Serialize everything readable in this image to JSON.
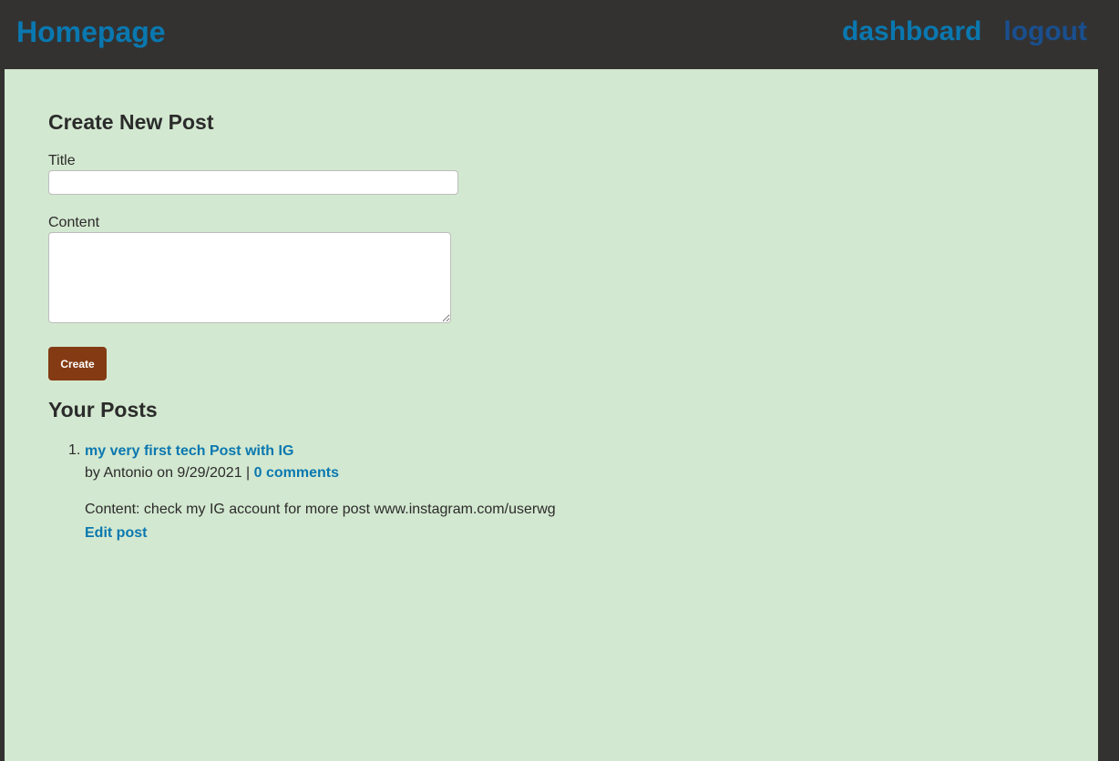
{
  "header": {
    "brand": "Homepage",
    "nav": {
      "dashboard": "dashboard",
      "logout": "logout"
    }
  },
  "create_post": {
    "heading": "Create New Post",
    "title_label": "Title",
    "title_value": "",
    "content_label": "Content",
    "content_value": "",
    "button_label": "Create"
  },
  "your_posts": {
    "heading": "Your Posts",
    "posts": [
      {
        "number": "1.",
        "title": "my very first tech Post with IG",
        "meta_prefix": "by Antonio on 9/29/2021 |",
        "comments": "0 comments",
        "content": "Content: check my IG account for more post www.instagram.com/userwg",
        "edit_label": "Edit post"
      }
    ]
  },
  "colors": {
    "header_bg": "#333231",
    "main_bg": "#d3e8d0",
    "link": "#0a78b0",
    "logout": "#1a4f8e",
    "button": "#843b14"
  }
}
